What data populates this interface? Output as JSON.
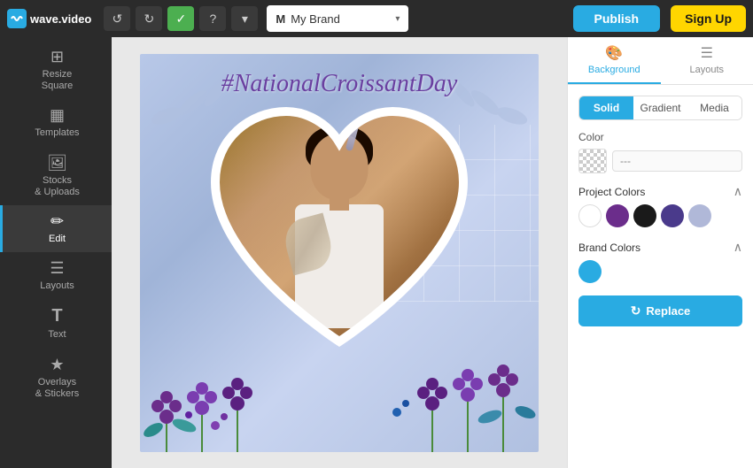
{
  "app": {
    "logo_text": "wave.video"
  },
  "topbar": {
    "undo_label": "↺",
    "redo_label": "↻",
    "check_label": "✓",
    "help_label": "?",
    "dropdown_label": "▾",
    "brand_letter": "M",
    "brand_name": "My Brand",
    "publish_label": "Publish",
    "signup_label": "Sign Up"
  },
  "sidebar": {
    "items": [
      {
        "id": "resize",
        "label": "Resize\nSquare",
        "icon": "⊞"
      },
      {
        "id": "templates",
        "label": "Templates",
        "icon": "▦"
      },
      {
        "id": "stocks",
        "label": "Stocks\n& Uploads",
        "icon": "🖼"
      },
      {
        "id": "edit",
        "label": "Edit",
        "icon": "✏"
      },
      {
        "id": "layouts",
        "label": "Layouts",
        "icon": "⊟"
      },
      {
        "id": "text",
        "label": "Text",
        "icon": "T"
      },
      {
        "id": "overlays",
        "label": "Overlays\n& Stickers",
        "icon": "★"
      }
    ]
  },
  "canvas": {
    "title": "#NationalCroissantDay"
  },
  "right_panel": {
    "tabs": [
      {
        "id": "background",
        "label": "Background",
        "icon": "🖌"
      },
      {
        "id": "layouts",
        "label": "Layouts",
        "icon": "⊟"
      }
    ],
    "active_tab": "background",
    "type_options": [
      "Solid",
      "Gradient",
      "Media"
    ],
    "active_type": "Solid",
    "color_section": {
      "label": "Color",
      "value": "---"
    },
    "project_colors": {
      "label": "Project Colors",
      "colors": [
        {
          "hex": "#ffffff",
          "class": "white"
        },
        {
          "hex": "#6b2d8b"
        },
        {
          "hex": "#1a1a1a"
        },
        {
          "hex": "#4a3a8b"
        },
        {
          "hex": "#b0b8d8"
        }
      ]
    },
    "brand_colors": {
      "label": "Brand Colors",
      "colors": [
        {
          "hex": "#29abe2"
        }
      ]
    },
    "replace_label": "Replace"
  }
}
